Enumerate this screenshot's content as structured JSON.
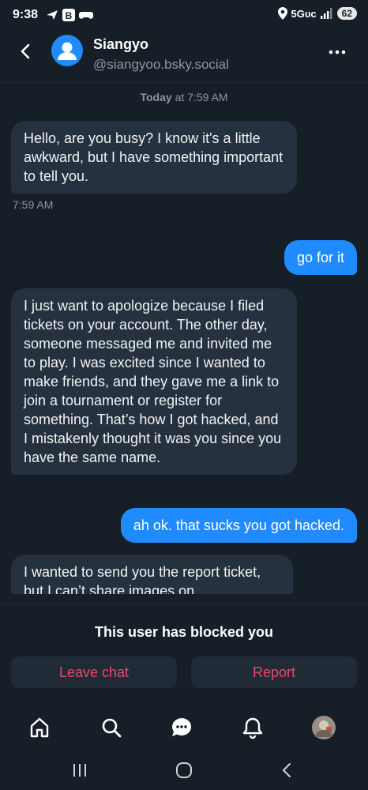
{
  "status": {
    "time": "9:38",
    "network": "5Gᴜᴄ",
    "battery": "62"
  },
  "header": {
    "name": "Siangyo",
    "handle": "@siangyoo.bsky.social"
  },
  "separator": {
    "day": "Today",
    "at": " at 7:59 AM"
  },
  "messages": [
    {
      "from": "them",
      "text": "Hello, are you busy? I know it's a little awkward, but I have something important to tell you."
    },
    {
      "from": "me",
      "text": "go for it"
    },
    {
      "from": "them",
      "text": "I just want to apologize because I filed tickets on your account. The other day, someone messaged me and invited me to play. I was excited since I wanted to make friends, and they gave me a link to join a tournament or register for something. That’s how I got hacked, and I mistakenly thought it was you since you have the same name."
    },
    {
      "from": "me",
      "text": "ah ok. that sucks you got hacked."
    },
    {
      "from": "them",
      "text": "I wanted to send you the report ticket, but I can’t share images on"
    }
  ],
  "message_time": "7:59 AM",
  "blocked": {
    "notice": "This user has blocked you",
    "leave_label": "Leave chat",
    "report_label": "Report"
  },
  "tabs": [
    "home-icon",
    "search-icon",
    "chat-icon",
    "notifications-icon",
    "profile-avatar"
  ],
  "colors": {
    "background": "#161e27",
    "bubble_in": "#26313f",
    "bubble_out": "#208bfe",
    "danger": "#ec4868",
    "muted": "#8b98a5"
  }
}
